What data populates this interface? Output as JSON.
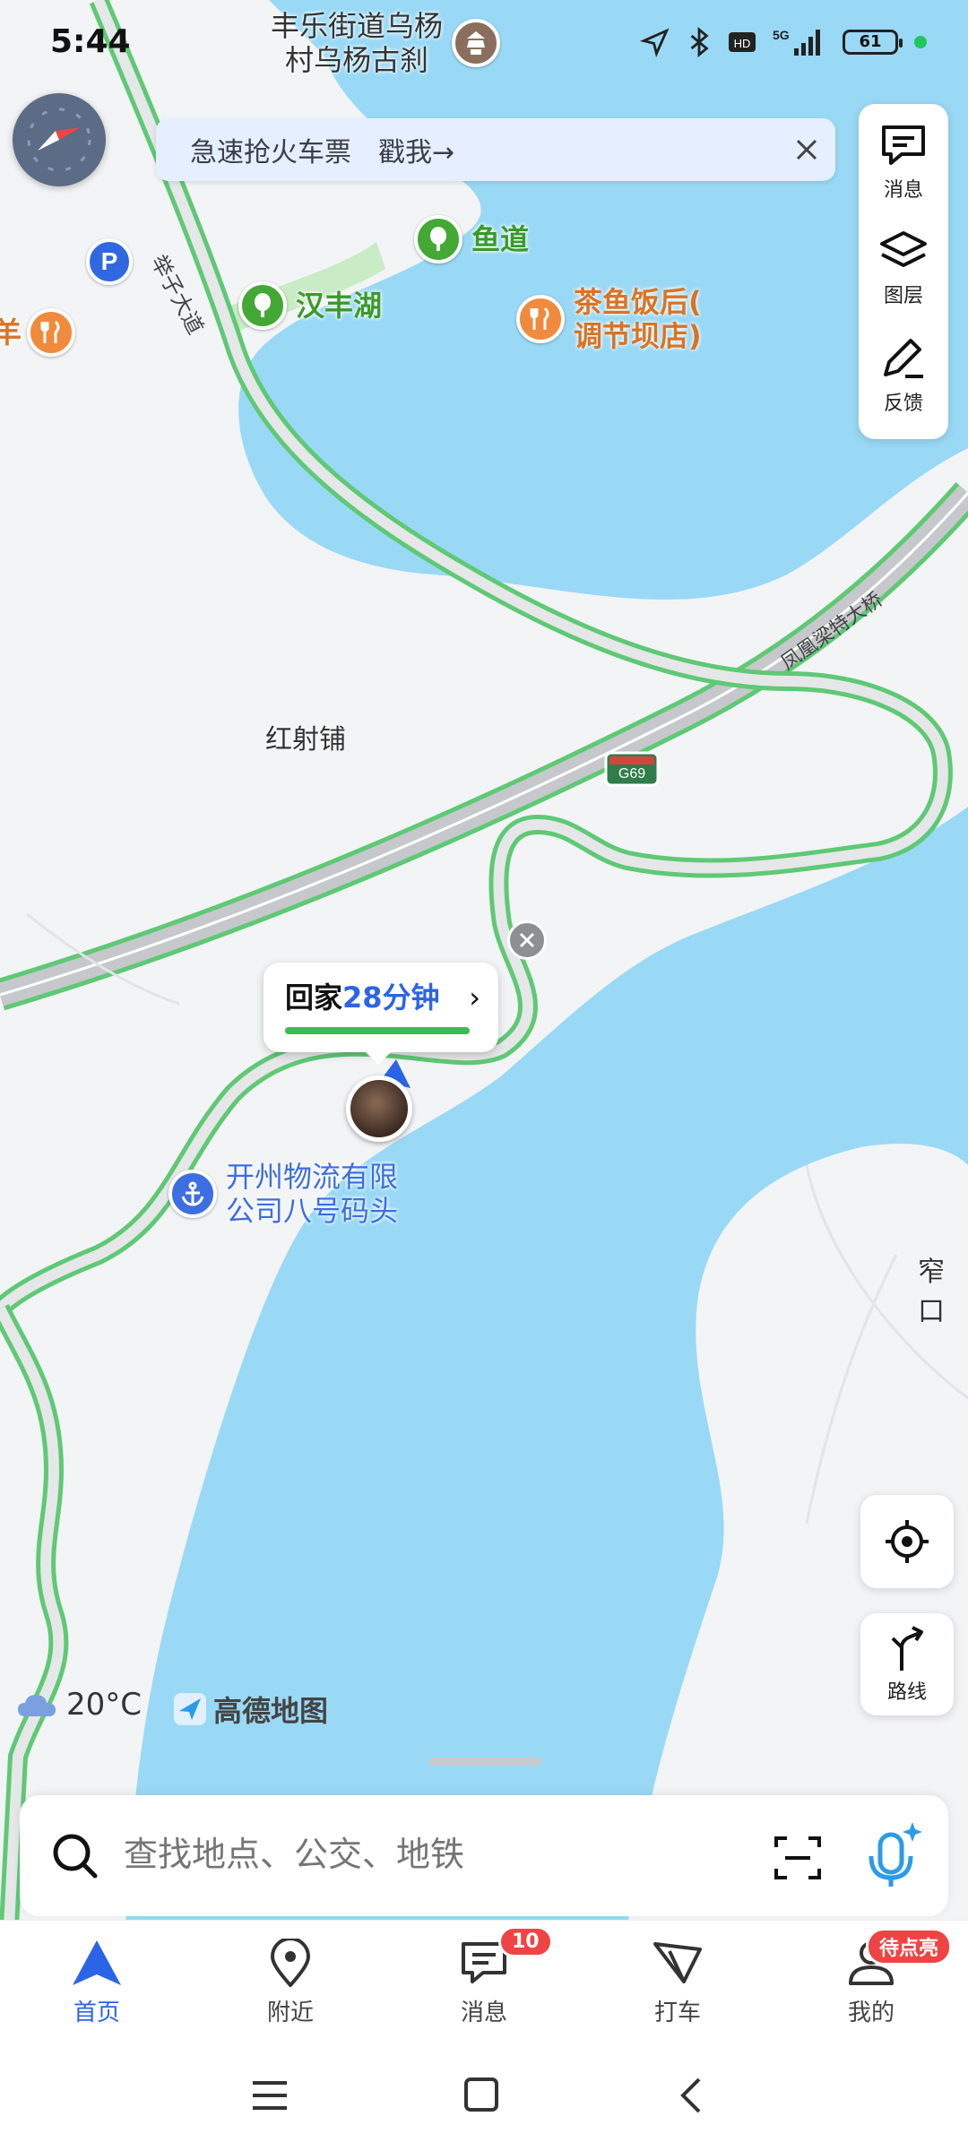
{
  "status_bar": {
    "time": "5:44",
    "battery": "61",
    "icons": [
      "location-icon",
      "bluetooth-icon",
      "hd-icon",
      "5g-signal-icon",
      "battery-icon"
    ]
  },
  "banner": {
    "text": "急速抢火车票　戳我→"
  },
  "map_tools": {
    "messages": "消息",
    "layers": "图层",
    "feedback": "反馈"
  },
  "map": {
    "pois": [
      {
        "label": "丰乐街道乌杨\n村乌杨古刹",
        "type": "temple"
      },
      {
        "label": "鱼道",
        "type": "park"
      },
      {
        "label": "汉丰湖",
        "type": "park"
      },
      {
        "label": "茶鱼饭后(\n调节坝店)",
        "type": "restaurant"
      },
      {
        "label": "开州物流有限\n公司八号码头",
        "type": "dock"
      },
      {
        "label": "羊",
        "type": "restaurant"
      }
    ],
    "places": {
      "hongshepu": "红射铺",
      "zhaikou": "窄口"
    },
    "roads": {
      "juzi_avenue": "举子大道",
      "bridge": "凤凰梁特大桥",
      "highway": "G69"
    }
  },
  "route_card": {
    "prefix": "回家",
    "time": "28分钟",
    "arrow": "›"
  },
  "weather": {
    "temp": "20°C"
  },
  "brand": {
    "name": "高德地图"
  },
  "controls": {
    "route": "路线"
  },
  "search": {
    "placeholder": "查找地点、公交、地铁"
  },
  "tabs": [
    {
      "label": "首页",
      "active": true
    },
    {
      "label": "附近"
    },
    {
      "label": "消息",
      "badge": "10"
    },
    {
      "label": "打车"
    },
    {
      "label": "我的",
      "badge": "待点亮"
    }
  ],
  "colors": {
    "water": "#9ad9f6",
    "land": "#f3f4f6",
    "road_green": "#5fc976",
    "accent_blue": "#2c64e8",
    "badge_red": "#ef4444"
  }
}
